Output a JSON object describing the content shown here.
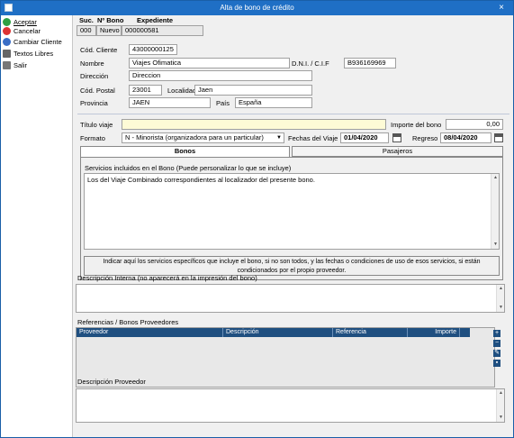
{
  "window": {
    "title": "Alta de bono de crédito",
    "close": "×"
  },
  "sidebar": {
    "items": [
      {
        "label": "Aceptar",
        "icon": "check-icon",
        "color": "#2ea043"
      },
      {
        "label": "Cancelar",
        "icon": "cancel-icon",
        "color": "#d33"
      },
      {
        "label": "Cambiar Cliente",
        "icon": "users-icon",
        "color": "#3a6ec6"
      },
      {
        "label": "Textos Libres",
        "icon": "keyboard-icon",
        "color": "#666"
      },
      {
        "label": "Salir",
        "icon": "exit-icon",
        "color": "#777"
      }
    ]
  },
  "header": {
    "suc_label": "Suc.",
    "bono_label": "Nº Bono",
    "exp_label": "Expediente",
    "suc_value": "000",
    "bono_value": "Nuevo",
    "exp_value": "000000581"
  },
  "client": {
    "cod_label": "Cód. Cliente",
    "cod_value": "43000000125",
    "nombre_label": "Nombre",
    "nombre_value": "Viajes Ofimatica",
    "dni_label": "D.N.I. / C.I.F",
    "dni_value": "B936169969",
    "dir_label": "Dirección",
    "dir_value": "Direccion",
    "cp_label": "Cód. Postal",
    "cp_value": "23001",
    "loc_label": "Localidad",
    "loc_value": "Jaen",
    "prov_label": "Provincia",
    "prov_value": "JAEN",
    "pais_label": "País",
    "pais_value": "España"
  },
  "trip": {
    "titulo_label": "Título viaje",
    "titulo_value": "",
    "importe_label": "Importe del bono",
    "importe_value": "0,00",
    "formato_label": "Formato",
    "formato_value": "N - Minorista (organizadora para un particular)",
    "fechas_label": "Fechas del Viaje",
    "fecha_ida": "01/04/2020",
    "regreso_label": "Regreso",
    "fecha_regreso": "08/04/2020"
  },
  "tabs": [
    {
      "label": "Bonos"
    },
    {
      "label": "Pasajeros"
    }
  ],
  "bonos": {
    "servicios_label": "Servicios incluidos en el Bono (Puede personalizar lo que se incluye)",
    "servicios_text": "Los del Viaje Combinado correspondientes al localizador del presente bono.",
    "note_line1": "Indicar aquí los servicios específicos que incluye el bono, si no son todos, y las fechas o condiciones de uso de esos servicios, si están",
    "note_line2": "condicionados por el propio proveedor."
  },
  "desc_interna_label": "Descripción Interna (no aparecerá en la impresión del bono)",
  "refs": {
    "label": "Referencias / Bonos Proveedores",
    "columns": [
      "Proveedor",
      "Descripción",
      "Referencia",
      "Importe"
    ]
  },
  "desc_proveedor_label": "Descripción Proveedor"
}
